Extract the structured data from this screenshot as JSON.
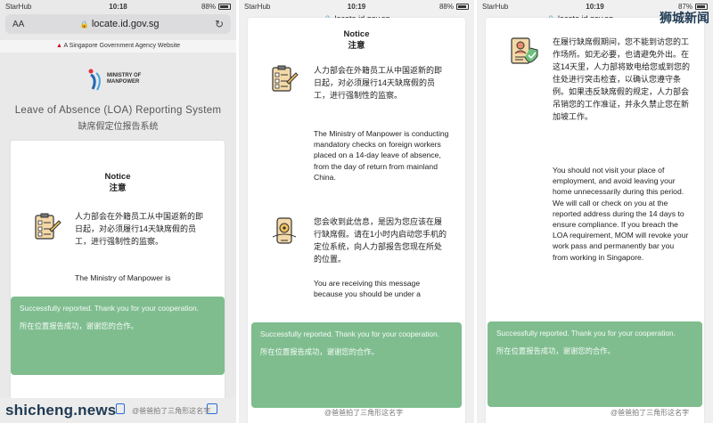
{
  "brand_bottom": "shicheng.news",
  "brand_top": "狮城新闻",
  "screens": [
    {
      "status": {
        "carrier": "StarHub",
        "time": "10:18",
        "battery": "88%"
      },
      "url_prefix": "AA",
      "url": "locate.id.gov.sg",
      "gov_banner": "A Singapore Government Agency Website",
      "logo_line1": "MINISTRY OF",
      "logo_line2": "MANPOWER",
      "system_title": "Leave of Absence (LOA) Reporting System",
      "system_title_zh": "缺席假定位报告系统",
      "notice_title": "Notice",
      "notice_title_zh": "注意",
      "para_zh": "人力部会在外籍员工从中国返新的即日起，对必须履行14天缺席假的员工，进行强制性的监察。",
      "para_en": "The Ministry of Manpower is",
      "toast_en": "Successfully reported. Thank you for your cooperation.",
      "toast_zh": "所在位置报告成功，谢谢您的合作。",
      "watermark": "@爸爸拍了三角形这名字"
    },
    {
      "status": {
        "carrier": "StarHub",
        "time": "10:19",
        "battery": "88%"
      },
      "url": "locate.id.gov.sg",
      "notice_title": "Notice",
      "notice_title_zh": "注意",
      "para1_zh": "人力部会在外籍员工从中国返新的即日起，对必须履行14天缺席假的员工，进行强制性的监察。",
      "para1_en": "The Ministry of Manpower is conducting mandatory checks on foreign workers placed on a 14-day leave of absence, from the day of return from mainland China.",
      "para2_zh": "您会收到此信息，是因为您应该在履行缺席假。请在1小时内启动您手机的定位系统，向人力部报告您现在所处的位置。",
      "para2_en": "You are receiving this message because you should be under a",
      "toast_en": "Successfully reported. Thank you for your cooperation.",
      "toast_zh": "所在位置报告成功，谢谢您的合作。",
      "watermark": "@爸爸拍了三角形这名字"
    },
    {
      "status": {
        "carrier": "StarHub",
        "time": "10:19",
        "battery": "87%"
      },
      "url": "locate.id.gov.sg",
      "para3_zh": "在履行缺席假期间，您不能到访您的工作场所。如无必要，也请避免外出。在这14天里，人力部将致电给您或到您的住处进行突击检查，以确认您遵守条例。如果违反缺席假的规定，人力部会吊销您的工作准证，并永久禁止您在新加坡工作。",
      "para3_en": "You should not visit your place of employment, and avoid leaving your home unnecessarily during this period. We will call or check on you at the reported address during the 14 days to ensure compliance. If you breach the LOA requirement, MOM will revoke your work pass and permanently bar you from working in Singapore.",
      "toast_en": "Successfully reported. Thank you for your cooperation.",
      "toast_zh": "所在位置报告成功，谢谢您的合作。",
      "watermark": "@爸爸拍了三角形这名字"
    }
  ]
}
